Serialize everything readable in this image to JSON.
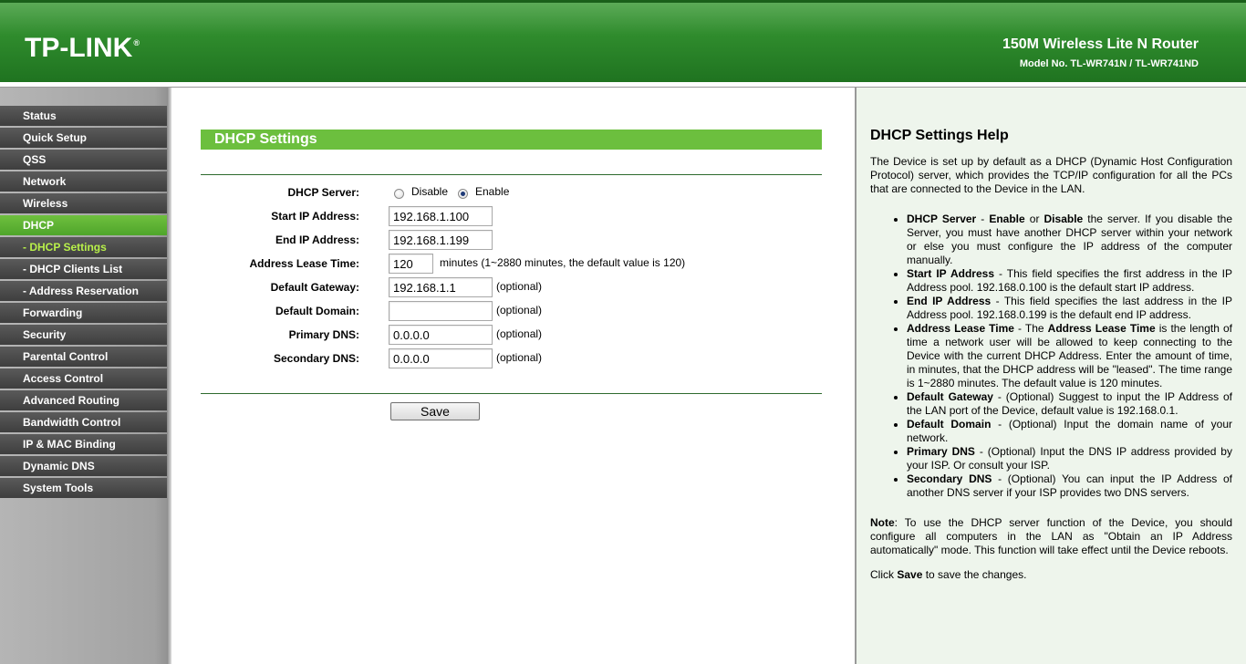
{
  "header": {
    "logo": "TP-LINK",
    "logo_reg": "®",
    "product_name": "150M Wireless Lite N Router",
    "model_no": "Model No. TL-WR741N / TL-WR741ND"
  },
  "sidebar": {
    "items": [
      {
        "label": "Status"
      },
      {
        "label": "Quick Setup"
      },
      {
        "label": "QSS"
      },
      {
        "label": "Network"
      },
      {
        "label": "Wireless"
      },
      {
        "label": "DHCP"
      },
      {
        "label": "- DHCP Settings"
      },
      {
        "label": "- DHCP Clients List"
      },
      {
        "label": "- Address Reservation"
      },
      {
        "label": "Forwarding"
      },
      {
        "label": "Security"
      },
      {
        "label": "Parental Control"
      },
      {
        "label": "Access Control"
      },
      {
        "label": "Advanced Routing"
      },
      {
        "label": "Bandwidth Control"
      },
      {
        "label": "IP & MAC Binding"
      },
      {
        "label": "Dynamic DNS"
      },
      {
        "label": "System Tools"
      }
    ]
  },
  "main": {
    "title": "DHCP Settings",
    "dhcp_server": {
      "label": "DHCP Server:",
      "option_disable": "Disable",
      "option_enable": "Enable",
      "selected": "Enable"
    },
    "start_ip": {
      "label": "Start IP Address:",
      "value": "192.168.1.100"
    },
    "end_ip": {
      "label": "End IP Address:",
      "value": "192.168.1.199"
    },
    "lease_time": {
      "label": "Address Lease Time:",
      "value": "120",
      "hint": "minutes (1~2880 minutes, the default value is 120)"
    },
    "gateway": {
      "label": "Default Gateway:",
      "value": "192.168.1.1",
      "hint": "(optional)"
    },
    "domain": {
      "label": "Default Domain:",
      "value": "",
      "hint": "(optional)"
    },
    "primary_dns": {
      "label": "Primary DNS:",
      "value": "0.0.0.0",
      "hint": "(optional)"
    },
    "secondary_dns": {
      "label": "Secondary DNS:",
      "value": "0.0.0.0",
      "hint": "(optional)"
    },
    "save_label": "Save"
  },
  "help": {
    "title": "DHCP Settings Help",
    "intro": "The Device is set up by default as a DHCP (Dynamic Host Configuration Protocol) server, which provides the TCP/IP configuration for all the PCs that are connected to the Device in the LAN.",
    "items": [
      {
        "t1": "DHCP Server",
        "t2": " - ",
        "t3": "Enable",
        "t4": " or ",
        "t5": "Disable",
        "t6": " the server. If you disable the Server, you must have another DHCP server within your network or else you must configure the IP address of the computer manually."
      },
      {
        "t1": "Start IP Address",
        "t2": " - This field specifies the first address in the IP Address pool. 192.168.0.100 is the default start IP address."
      },
      {
        "t1": "End IP Address",
        "t2": " - This field specifies the last address in the IP Address pool. 192.168.0.199 is the default end IP address."
      },
      {
        "t1": "Address Lease Time",
        "t2": " - The ",
        "t3": "Address Lease Time",
        "t4": " is the length of time a network user will be allowed to keep connecting to the Device with the current DHCP Address. Enter the amount of time, in minutes, that the DHCP address will be \"leased\". The time range is 1~2880 minutes. The default value is 120 minutes."
      },
      {
        "t1": "Default Gateway",
        "t2": " - (Optional) Suggest to input the IP Address of the LAN port of the Device, default value is 192.168.0.1."
      },
      {
        "t1": "Default Domain",
        "t2": " - (Optional) Input the domain name of your network."
      },
      {
        "t1": "Primary DNS",
        "t2": " - (Optional) Input the DNS IP address provided by your ISP. Or consult your ISP."
      },
      {
        "t1": "Secondary DNS",
        "t2": " - (Optional) You can input the IP Address of another DNS server if your ISP provides two DNS servers."
      }
    ],
    "note_label": "Note",
    "note_text": ": To use the DHCP server function of the Device, you should configure all computers in the LAN as \"Obtain an IP Address automatically\" mode. This function will take effect until the Device reboots.",
    "click_pre": "Click ",
    "click_save": "Save",
    "click_post": " to save the changes."
  }
}
